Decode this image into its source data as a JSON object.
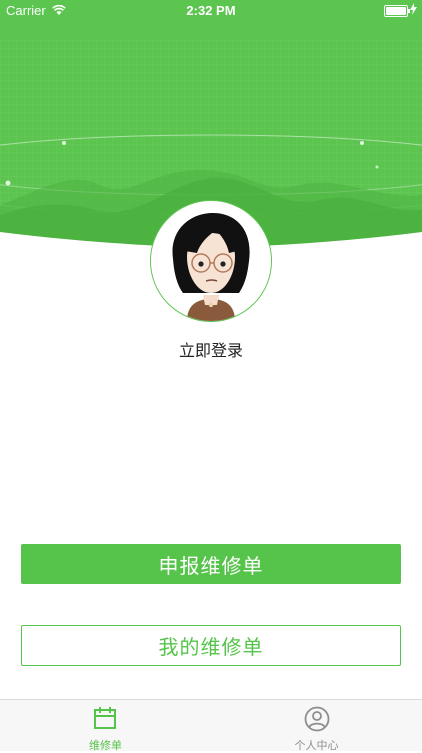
{
  "status_bar": {
    "carrier": "Carrier",
    "time": "2:32 PM"
  },
  "profile": {
    "login_label": "立即登录"
  },
  "actions": {
    "report_label": "申报维修单",
    "my_orders_label": "我的维修单"
  },
  "tab_bar": {
    "items": [
      {
        "label": "维修单",
        "icon": "calendar-icon",
        "active": true
      },
      {
        "label": "个人中心",
        "icon": "person-circle-icon",
        "active": false
      }
    ]
  },
  "colors": {
    "brand_green": "#56c34a",
    "hero_green": "#5cc550",
    "tab_inactive": "#8e8e8e"
  }
}
